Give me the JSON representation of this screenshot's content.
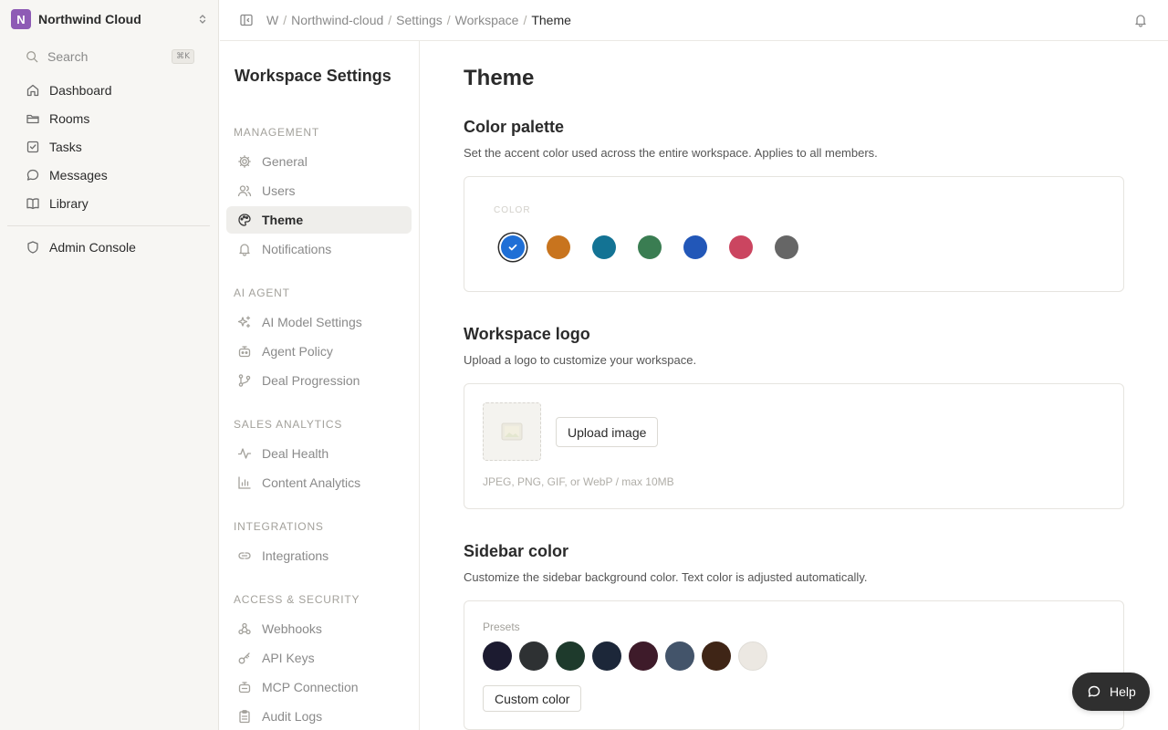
{
  "workspace": {
    "initial": "N",
    "name": "Northwind Cloud",
    "avatar_color": "#8e5bb5"
  },
  "search": {
    "label": "Search",
    "shortcut": "⌘K"
  },
  "nav": [
    {
      "label": "Dashboard",
      "icon": "home-icon"
    },
    {
      "label": "Rooms",
      "icon": "folder-icon"
    },
    {
      "label": "Tasks",
      "icon": "checkbox-icon"
    },
    {
      "label": "Messages",
      "icon": "chat-bubble-icon"
    },
    {
      "label": "Library",
      "icon": "book-icon"
    }
  ],
  "admin": {
    "label": "Admin Console",
    "icon": "shield-icon"
  },
  "breadcrumb": [
    "W",
    "Northwind-cloud",
    "Settings",
    "Workspace",
    "Theme"
  ],
  "settings": {
    "title": "Workspace Settings",
    "groups": [
      {
        "label": "MANAGEMENT",
        "items": [
          {
            "label": "General",
            "icon": "gear-icon"
          },
          {
            "label": "Users",
            "icon": "users-icon"
          },
          {
            "label": "Theme",
            "icon": "palette-icon",
            "active": true
          },
          {
            "label": "Notifications",
            "icon": "bell-icon"
          }
        ]
      },
      {
        "label": "AI AGENT",
        "items": [
          {
            "label": "AI Model Settings",
            "icon": "sparkles-icon"
          },
          {
            "label": "Agent Policy",
            "icon": "bot-icon"
          },
          {
            "label": "Deal Progression",
            "icon": "git-branch-icon"
          }
        ]
      },
      {
        "label": "SALES ANALYTICS",
        "items": [
          {
            "label": "Deal Health",
            "icon": "activity-icon"
          },
          {
            "label": "Content Analytics",
            "icon": "bar-chart-icon"
          }
        ]
      },
      {
        "label": "INTEGRATIONS",
        "items": [
          {
            "label": "Integrations",
            "icon": "link-icon"
          }
        ]
      },
      {
        "label": "ACCESS & SECURITY",
        "items": [
          {
            "label": "Webhooks",
            "icon": "webhook-icon"
          },
          {
            "label": "API Keys",
            "icon": "key-icon"
          },
          {
            "label": "MCP Connection",
            "icon": "plug-icon"
          },
          {
            "label": "Audit Logs",
            "icon": "clipboard-icon"
          }
        ]
      }
    ]
  },
  "main": {
    "title": "Theme",
    "palette": {
      "title": "Color palette",
      "description": "Set the accent color used across the entire workspace. Applies to all members.",
      "label": "COLOR",
      "colors": [
        "#1f6fd6",
        "#c8741e",
        "#137394",
        "#3a7d52",
        "#2257b8",
        "#cb4560",
        "#666666"
      ],
      "selected_index": 0
    },
    "logo": {
      "title": "Workspace logo",
      "description": "Upload a logo to customize your workspace.",
      "button": "Upload image",
      "hint": "JPEG, PNG, GIF, or WebP / max 10MB"
    },
    "sidebar_color": {
      "title": "Sidebar color",
      "description": "Customize the sidebar background color. Text color is adjusted automatically.",
      "presets_label": "Presets",
      "presets": [
        "#1c1b30",
        "#2e3133",
        "#1e3a2c",
        "#1c2739",
        "#3e1b2a",
        "#43546a",
        "#3f2516",
        "#ece8e2"
      ],
      "custom_button": "Custom color"
    }
  },
  "help": {
    "label": "Help"
  }
}
